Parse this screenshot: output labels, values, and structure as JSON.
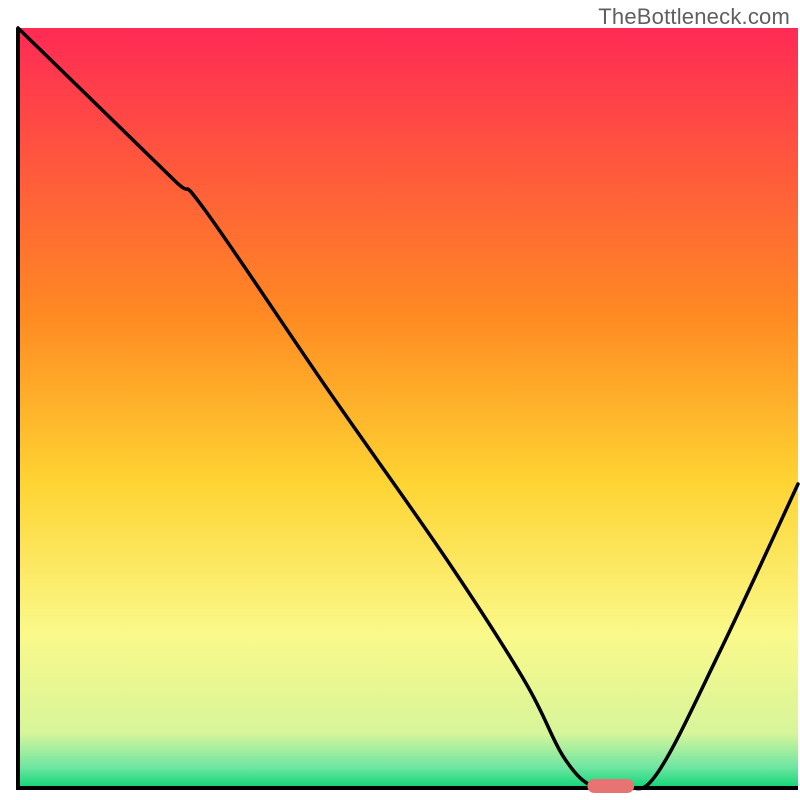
{
  "watermark": "TheBottleneck.com",
  "chart_data": {
    "type": "line",
    "title": "",
    "xlabel": "",
    "ylabel": "",
    "xlim": [
      0,
      100
    ],
    "ylim": [
      0,
      100
    ],
    "grid": false,
    "legend": false,
    "gradient_stops": [
      {
        "pos": 0.0,
        "color": "#ff2a55"
      },
      {
        "pos": 0.38,
        "color": "#ff8a22"
      },
      {
        "pos": 0.6,
        "color": "#fed432"
      },
      {
        "pos": 0.8,
        "color": "#faf98a"
      },
      {
        "pos": 0.93,
        "color": "#d7f59a"
      },
      {
        "pos": 0.975,
        "color": "#6fe6a2"
      },
      {
        "pos": 1.0,
        "color": "#18d77a"
      }
    ],
    "series": [
      {
        "name": "bottleneck-curve",
        "x": [
          0,
          8,
          20,
          24,
          40,
          55,
          65,
          70,
          74,
          78,
          82,
          90,
          100
        ],
        "y": [
          100,
          92,
          80,
          76,
          52,
          30,
          14,
          4,
          0,
          0,
          2,
          18,
          40
        ]
      }
    ],
    "marker": {
      "name": "optimal-range",
      "x_center": 76,
      "width": 6,
      "color": "#e77373"
    },
    "axes": {
      "stroke": "#000000",
      "stroke_width": 4
    }
  }
}
